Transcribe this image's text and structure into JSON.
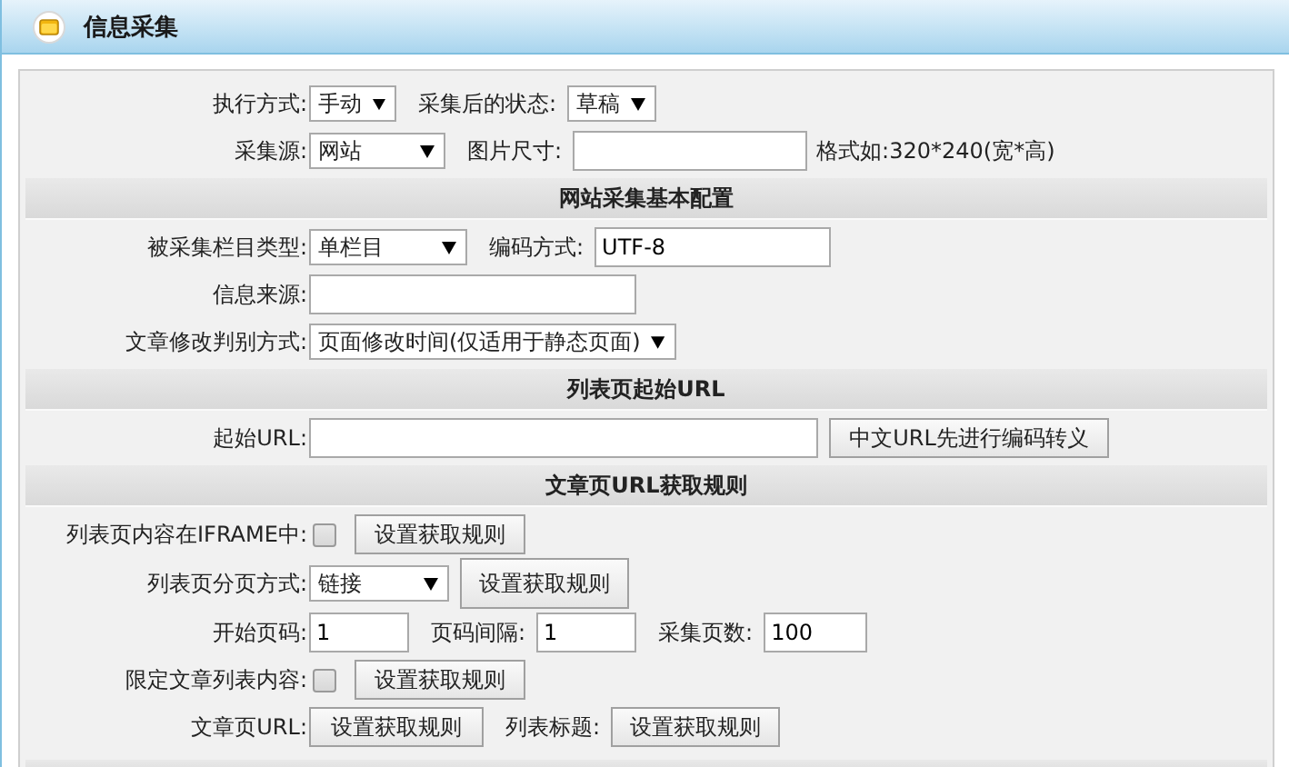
{
  "window": {
    "title": "信息采集"
  },
  "sections": [
    {
      "rows": [
        {
          "label": "执行方式:",
          "items": [
            {
              "kind": "select",
              "value": "手动"
            },
            {
              "kind": "text",
              "text": "采集后的状态:"
            },
            {
              "kind": "select",
              "value": "草稿"
            }
          ]
        },
        {
          "label": "采集源:",
          "items": [
            {
              "kind": "select",
              "value": "网站"
            },
            {
              "kind": "text",
              "text": "图片尺寸:"
            },
            {
              "kind": "input"
            },
            {
              "kind": "note",
              "text": "格式如:320*240(宽*高)"
            }
          ]
        }
      ]
    },
    {
      "heading": "网站采集基本配置",
      "rows": [
        {
          "label": "被采集栏目类型:",
          "items": [
            {
              "kind": "select",
              "value": "单栏目"
            },
            {
              "kind": "text",
              "text": "编码方式:"
            },
            {
              "kind": "input",
              "value": "UTF-8"
            }
          ]
        },
        {
          "label": "信息来源:",
          "items": [
            {
              "kind": "input"
            }
          ]
        },
        {
          "label": "文章修改判别方式:",
          "items": [
            {
              "kind": "select",
              "value": "页面修改时间(仅适用于静态页面)"
            }
          ]
        }
      ]
    },
    {
      "heading": "列表页起始URL",
      "rows": [
        {
          "label": "起始URL:",
          "items": [
            {
              "kind": "input"
            },
            {
              "kind": "button",
              "text": "中文URL先进行编码转义"
            }
          ]
        }
      ]
    },
    {
      "heading": "文章页URL获取规则",
      "rows": [
        {
          "label": "列表页内容在IFRAME中:",
          "items": [
            {
              "kind": "checkbox",
              "checked": false
            },
            {
              "kind": "button",
              "text": "设置获取规则"
            }
          ]
        },
        {
          "label": "列表页分页方式:",
          "items": [
            {
              "kind": "select",
              "value": "链接"
            },
            {
              "kind": "button",
              "text": "设置获取规则"
            }
          ]
        },
        {
          "label": "开始页码:",
          "items": [
            {
              "kind": "input",
              "value": "1"
            },
            {
              "kind": "text",
              "text": "页码间隔:"
            },
            {
              "kind": "input",
              "value": "1"
            },
            {
              "kind": "text",
              "text": "采集页数:"
            },
            {
              "kind": "input",
              "value": "100"
            }
          ]
        },
        {
          "label": "限定文章列表内容:",
          "items": [
            {
              "kind": "checkbox",
              "checked": false
            },
            {
              "kind": "button",
              "text": "设置获取规则"
            }
          ]
        },
        {
          "label": "文章页URL:",
          "items": [
            {
              "kind": "button",
              "text": "设置获取规则"
            },
            {
              "kind": "text",
              "text": "列表标题:"
            },
            {
              "kind": "button",
              "text": "设置获取规则"
            }
          ]
        }
      ]
    }
  ]
}
